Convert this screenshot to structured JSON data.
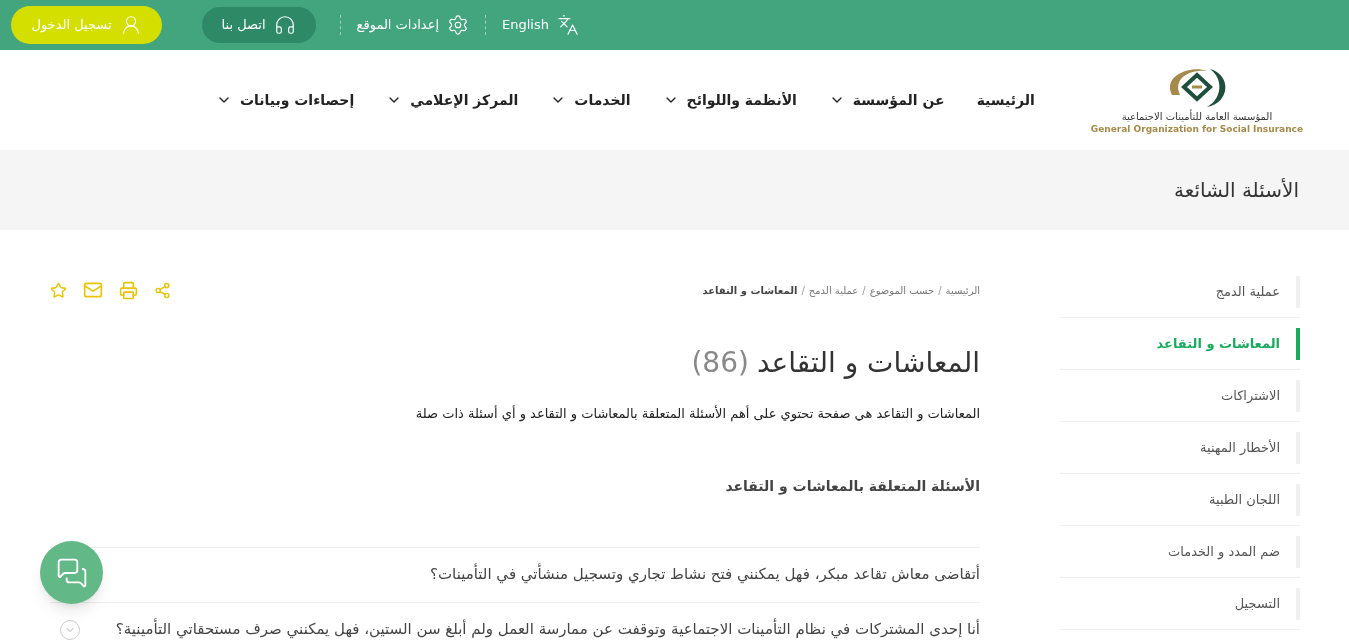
{
  "top_bar": {
    "language": "English",
    "settings": "إعدادات الموقع",
    "contact": "اتصل بنا",
    "login": "تسجيل الدخول"
  },
  "logo": {
    "arabic": "المؤسسة العامة للتأمينات الاجتماعية",
    "english": "General Organization for Social Insurance"
  },
  "nav": [
    {
      "label": "الرئيسية",
      "dropdown": false
    },
    {
      "label": "عن المؤسسة",
      "dropdown": true
    },
    {
      "label": "الأنظمة واللوائح",
      "dropdown": true
    },
    {
      "label": "الخدمات",
      "dropdown": true
    },
    {
      "label": "المركز الإعلامي",
      "dropdown": true
    },
    {
      "label": "إحصاءات وبيانات",
      "dropdown": true
    }
  ],
  "page_title": "الأسئلة الشائعة",
  "sidebar": [
    {
      "label": "عملية الدمج",
      "selected": false
    },
    {
      "label": "المعاشات و التقاعد",
      "selected": true
    },
    {
      "label": "الاشتراكات",
      "selected": false
    },
    {
      "label": "الأخطار المهنية",
      "selected": false
    },
    {
      "label": "اللجان الطبية",
      "selected": false
    },
    {
      "label": "ضم المدد و الخدمات",
      "selected": false
    },
    {
      "label": "التسجيل",
      "selected": false
    }
  ],
  "breadcrumb": [
    {
      "kind": "link",
      "text": "الرئيسية"
    },
    {
      "kind": "separator",
      "text": "/"
    },
    {
      "kind": "link",
      "text": "حسب الموضوع"
    },
    {
      "kind": "separator",
      "text": "/"
    },
    {
      "kind": "link",
      "text": "عملية الدمج"
    },
    {
      "kind": "separator",
      "text": "/"
    },
    {
      "kind": "current",
      "text": "المعاشات و التقاعد"
    }
  ],
  "heading": {
    "title": "المعاشات و التقاعد",
    "count": "(86)"
  },
  "description": "المعاشات و التقاعد هي صفحة تحتوي على أهم الأسئلة المتعلقة بالمعاشات و التقاعد و أي أسئلة ذات صلة",
  "section_title": "الأسئلة المتعلقة بالمعاشات و التقاعد",
  "questions": [
    {
      "text": "أتقاضى معاش تقاعد مبكر، فهل يمكنني فتح نشاط تجاري وتسجيل منشأتي في التأمينات؟",
      "expander": false
    },
    {
      "text": "أنا إحدى المشتركات في نظام التأمينات الاجتماعية وتوقفت عن ممارسة العمل ولم أبلغ سن الستين، فهل يمكنني صرف مستحقاتي التأمينية؟",
      "expander": true
    }
  ]
}
